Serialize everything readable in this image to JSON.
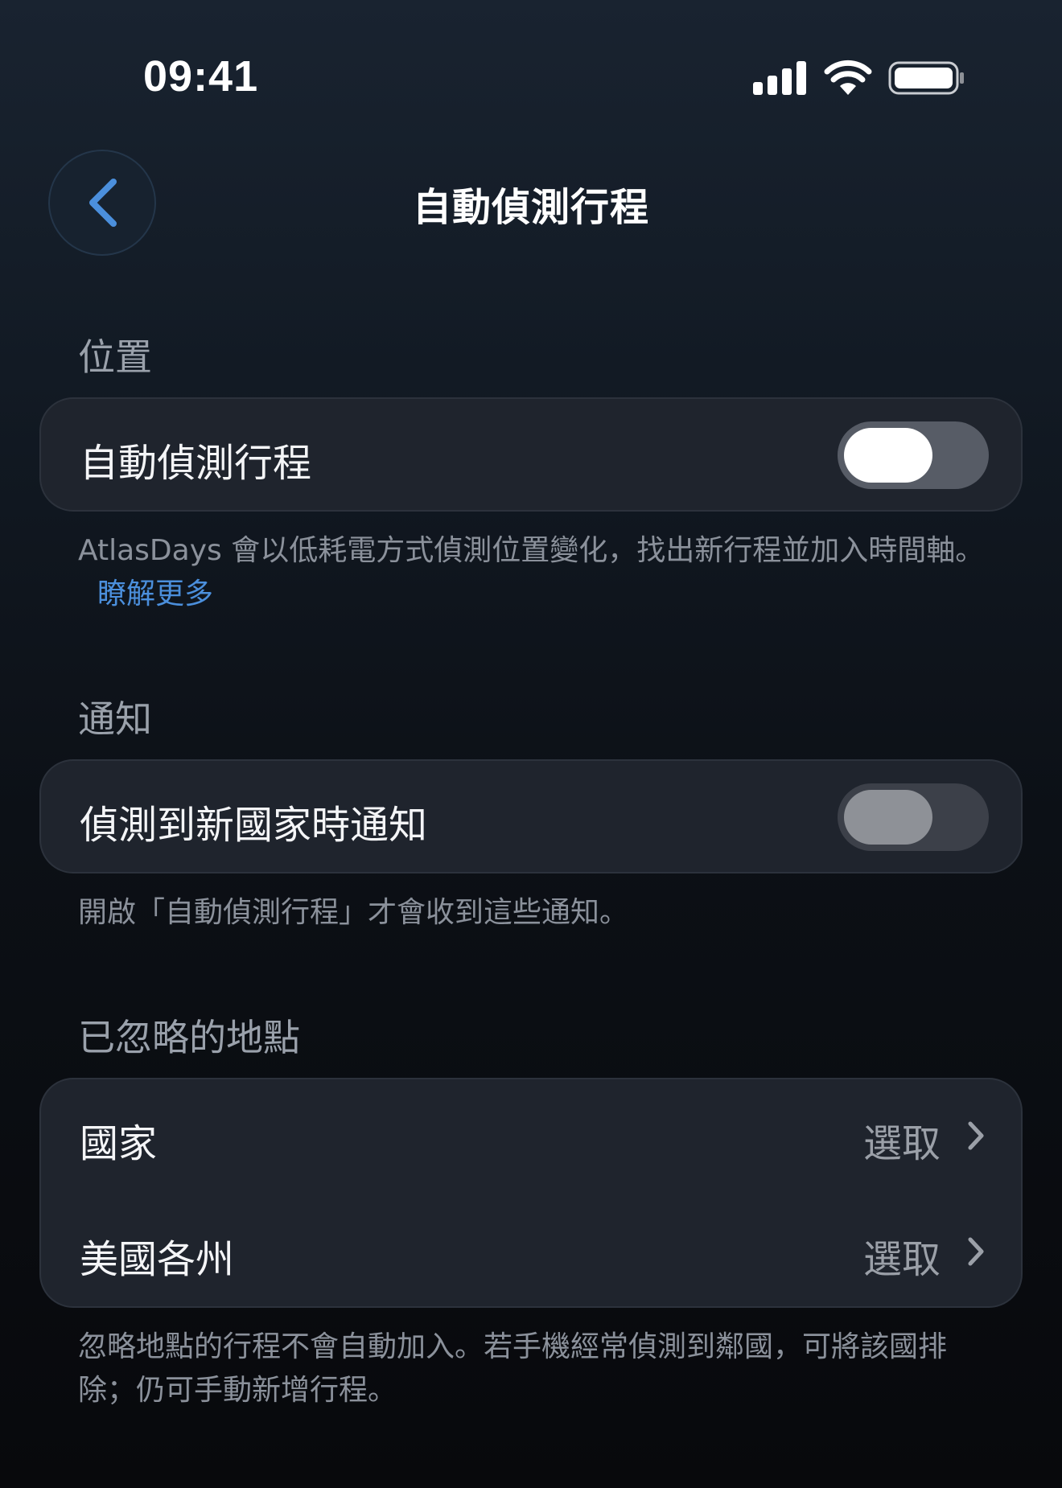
{
  "status_bar": {
    "time": "09:41",
    "icons": [
      "cellular-signal-icon",
      "wifi-icon",
      "battery-icon"
    ]
  },
  "nav": {
    "back_icon": "chevron-left-icon",
    "title": "自動偵測行程"
  },
  "colors": {
    "accent": "#4b8fdc",
    "card": "#1f242d",
    "secondary_text": "#8b919b"
  },
  "sections": {
    "location": {
      "header": "位置",
      "row_label": "自動偵測行程",
      "toggle_on": false,
      "footnote": "AtlasDays 會以低耗電方式偵測位置變化，找出新行程並加入時間軸。",
      "link": "瞭解更多"
    },
    "notifications": {
      "header": "通知",
      "row_label": "偵測到新國家時通知",
      "toggle_on": false,
      "toggle_enabled": false,
      "footnote": "開啟「自動偵測行程」才會收到這些通知。"
    },
    "ignored": {
      "header": "已忽略的地點",
      "rows": [
        {
          "label": "國家",
          "value": "選取"
        },
        {
          "label": "美國各州",
          "value": "選取"
        }
      ],
      "footnote": "忽略地點的行程不會自動加入。若手機經常偵測到鄰國，可將該國排除；仍可手動新增行程。"
    }
  }
}
